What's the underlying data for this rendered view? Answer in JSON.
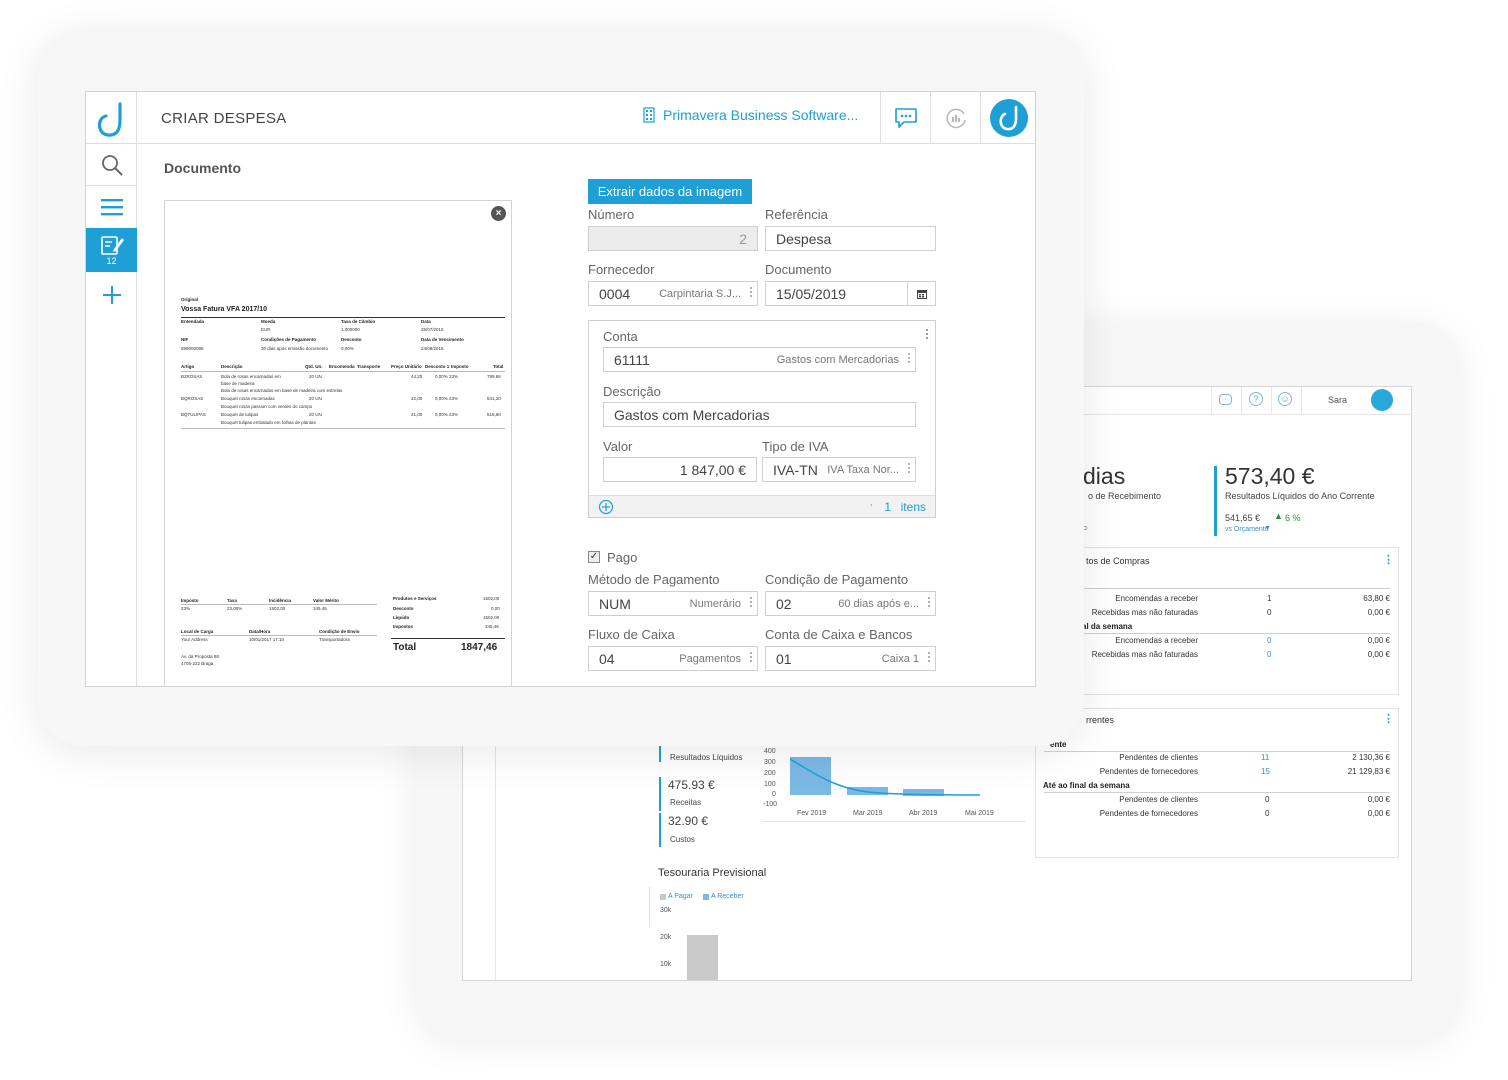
{
  "dashboard": {
    "user": "Sara",
    "kpi1": {
      "value": "dias",
      "label": "o de Recebimento",
      "footnote": "o"
    },
    "kpi2": {
      "value": "573,40 €",
      "label": "Resultados Líquidos do Ano Corrente",
      "budget_value": "541,65 €",
      "change": "6 %",
      "budget_label": "vs Orçamento"
    },
    "purchases_panel": {
      "title": "tos de Compras",
      "first_header": "",
      "rows_a": [
        {
          "label": "Encomendas a receber",
          "count": "1",
          "amount": "63,80 €"
        },
        {
          "label": "Recebidas mas não faturadas",
          "count": "0",
          "amount": "0,00 €"
        }
      ],
      "section_b": "al da semana",
      "rows_b": [
        {
          "label": "Encomendas a receber",
          "count": "0",
          "amount": "0,00 €"
        },
        {
          "label": "Recebidas mas não faturadas",
          "count": "0",
          "amount": "0,00 €"
        }
      ]
    },
    "accounts_panel": {
      "title": "rrentes",
      "section_a": "ente",
      "rows_a": [
        {
          "label": "Pendentes de clientes",
          "count": "11",
          "amount": "2 130,36 €"
        },
        {
          "label": "Pendentes de fornecedores",
          "count": "15",
          "amount": "21 129,83 €"
        }
      ],
      "section_b": "Até ao final da semana",
      "rows_b": [
        {
          "label": "Pendentes de clientes",
          "count": "0",
          "amount": "0,00 €"
        },
        {
          "label": "Pendentes de fornecedores",
          "count": "0",
          "amount": "0,00 €"
        }
      ]
    },
    "results": {
      "label": "Resultados Líquidos",
      "receitas_value": "475.93 €",
      "receitas_label": "Receitas",
      "custos_value": "32.90 €",
      "custos_label": "Custos"
    },
    "mini_chart": {
      "y_ticks": [
        "400",
        "300",
        "200",
        "100",
        "0",
        "-100"
      ],
      "x_ticks": [
        "Fev 2019",
        "Mar 2019",
        "Abr 2019",
        "Mai 2019"
      ]
    },
    "treasury": {
      "title": "Tesouraria Previsional",
      "legend_pay": "A Pagar",
      "legend_receive": "A Receber",
      "y_ticks": [
        "30k",
        "20k",
        "10k"
      ]
    }
  },
  "app": {
    "page_title": "CRIAR DESPESA",
    "company": "Primavera Business Software...",
    "sidebar_badge": "12",
    "section_title": "Documento",
    "extract_button": "Extrair dados da imagem",
    "form": {
      "numero_label": "Número",
      "numero_value": "2",
      "referencia_label": "Referência",
      "referencia_value": "Despesa",
      "fornecedor_label": "Fornecedor",
      "fornecedor_code": "0004",
      "fornecedor_name": "Carpintaria S.J...",
      "documento_label": "Documento",
      "documento_value": "15/05/2019",
      "conta_label": "Conta",
      "conta_code": "61111",
      "conta_name": "Gastos com Mercadorias",
      "descricao_label": "Descrição",
      "descricao_value": "Gastos com Mercadorias",
      "valor_label": "Valor",
      "valor_value": "1 847,00 €",
      "iva_label": "Tipo de IVA",
      "iva_code": "IVA-TN",
      "iva_name": "IVA Taxa Nor...",
      "items_count": "1",
      "items_label": "itens",
      "pago_label": "Pago",
      "metodo_label": "Método de Pagamento",
      "metodo_code": "NUM",
      "metodo_name": "Numerário",
      "condicao_label": "Condição de Pagamento",
      "condicao_code": "02",
      "condicao_name": "60 dias após e...",
      "fluxo_label": "Fluxo de Caixa",
      "fluxo_code": "04",
      "fluxo_name": "Pagamentos",
      "contacaixa_label": "Conta de Caixa e Bancos",
      "contacaixa_code": "01",
      "contacaixa_name": "Caixa 1"
    },
    "invoice": {
      "original": "Original",
      "title": "Vossa Fatura VFA 2017/10",
      "h1": [
        "Entendada",
        "Moeda",
        "Taxa de Câmbio",
        "Data"
      ],
      "v1": [
        "",
        "EUR",
        "1,000000",
        "25/07/2016"
      ],
      "h2": [
        "NIF",
        "Condições de Pagamento",
        "Desconto",
        "Data de Vencimento"
      ],
      "v2": [
        "599000098",
        "30 dias após emissão documento",
        "0,00%",
        "24/08/2016"
      ],
      "cols": [
        "Artigo",
        "Descrição",
        "Qtd. Un.",
        "Encomenda",
        "Transporte",
        "Preço Unitário",
        "Desconto 1",
        "Imposto",
        "Total"
      ],
      "lines": [
        {
          "a": "B2ROSAS",
          "d": "Bola de rosas encarnadas em",
          "q": "20  UN",
          "p": "44,20",
          "dc": "0,00%  23%",
          "t": "789,66"
        },
        {
          "a": "",
          "d": "base de madeira",
          "q": "",
          "p": "",
          "dc": "",
          "t": ""
        },
        {
          "a": "",
          "d": "Bola de rosas encarnadas em base de madeira com estrelas",
          "q": "",
          "p": "",
          "dc": "",
          "t": ""
        },
        {
          "a": "BQROSAS",
          "d": "Bouquet rosas encarnadas",
          "q": "20  UN",
          "p": "22,00",
          "dc": "0,00%  23%",
          "t": "541,20"
        },
        {
          "a": "",
          "d": "Bouquet rosas passion com verdes do campo",
          "q": "",
          "p": "",
          "dc": "",
          "t": ""
        },
        {
          "a": "BQTULIPAS",
          "d": "Bouquet de tulipas",
          "q": "20  UN",
          "p": "21,00",
          "dc": "0,00%  23%",
          "t": "516,60"
        },
        {
          "a": "",
          "d": "Bouquet tulipas embalado em folhas de plantas",
          "q": "",
          "p": "",
          "dc": "",
          "t": ""
        }
      ],
      "tax_heads": [
        "Imposto",
        "Taxa",
        "Incidência",
        "Valor Mérito"
      ],
      "tax_vals": [
        "23%",
        "23,00%",
        "1502,00",
        "345,46"
      ],
      "sum_labels": [
        "Produtos e Serviços",
        "Desconto",
        "Líquido",
        "Impostos"
      ],
      "sum_vals": [
        "1502,00",
        "0,00",
        "1502,00",
        "345,46"
      ],
      "load_heads": [
        "Local de Carga",
        "Data/Hora",
        "Condição de Envio"
      ],
      "load_vals": [
        "Your Address",
        "10/01/2017 17:10",
        "Transportadora"
      ],
      "total_label": "Total",
      "total_value": "1847,46",
      "addr1": "Av. da Proposta 88",
      "addr2": "4705-222 Braga"
    }
  }
}
